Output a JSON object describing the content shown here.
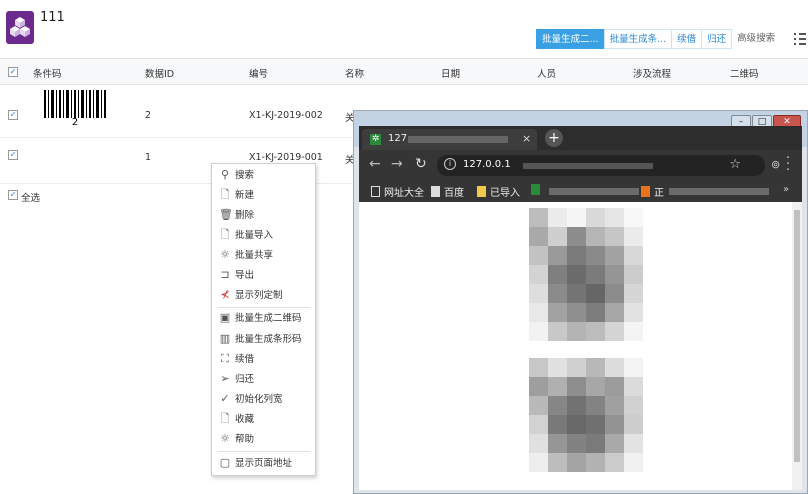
{
  "app": {
    "title": "111",
    "toolbar": [
      {
        "label": "批量生成二...",
        "primary": true
      },
      {
        "label": "批量生成条...",
        "primary": false
      },
      {
        "label": "续借",
        "primary": false
      },
      {
        "label": "归还",
        "primary": false
      }
    ],
    "advanced_search": "高级搜索",
    "columns": [
      "条件码",
      "数据ID",
      "编号",
      "名称",
      "日期",
      "人员",
      "涉及流程",
      "二维码"
    ],
    "rows": [
      {
        "barcode_text": "2",
        "id": "2",
        "code": "X1-KJ-2019-002",
        "name_partial": "关"
      },
      {
        "barcode_text": "",
        "id": "1",
        "code": "X1-KJ-2019-001",
        "name_partial": "关"
      }
    ],
    "select_all": "全选"
  },
  "context_menu": [
    {
      "label": "搜索",
      "icon": "search-icon"
    },
    {
      "label": "新建",
      "icon": "new-document-icon"
    },
    {
      "label": "删除",
      "icon": "trash-icon"
    },
    {
      "label": "批量导入",
      "icon": "import-icon"
    },
    {
      "label": "批量共享",
      "icon": "share-icon"
    },
    {
      "label": "导出",
      "icon": "export-icon"
    },
    {
      "label": "显示列定制",
      "icon": "columns-icon"
    },
    {
      "label": "批量生成二维码",
      "icon": "qrcode-icon"
    },
    {
      "label": "批量生成条形码",
      "icon": "barcode-icon"
    },
    {
      "label": "续借",
      "icon": "renew-icon"
    },
    {
      "label": "归还",
      "icon": "send-icon"
    },
    {
      "label": "初始化列宽",
      "icon": "check-circle-icon"
    },
    {
      "label": "收藏",
      "icon": "bookmark-icon"
    },
    {
      "label": "帮助",
      "icon": "help-icon"
    },
    {
      "label": "显示页面地址",
      "icon": "page-address-icon"
    }
  ],
  "browser": {
    "tab_title": "127",
    "url": "127.0.0.1",
    "bookmarks": [
      "网址大全",
      "百度",
      "已导入",
      "正"
    ]
  }
}
